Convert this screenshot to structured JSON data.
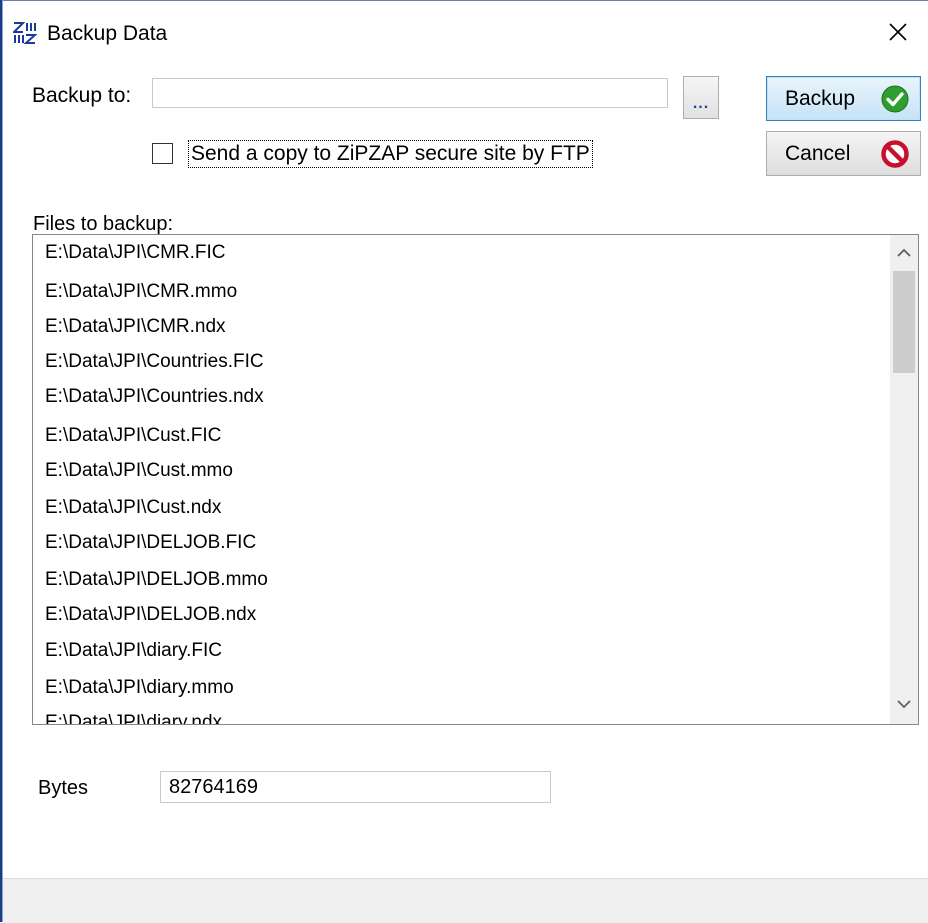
{
  "window": {
    "title": "Backup Data",
    "app_icon": "zipzap-logo-icon",
    "close_icon": "close-icon"
  },
  "backup_to": {
    "label": "Backup to:",
    "value": "",
    "browse_label": "..."
  },
  "ftp": {
    "checked": false,
    "label": "Send a copy to ZiPZAP secure site by FTP"
  },
  "buttons": {
    "backup_label": "Backup",
    "backup_icon": "check-circle-icon",
    "cancel_label": "Cancel",
    "cancel_icon": "no-entry-icon"
  },
  "files": {
    "label": "Files to backup:",
    "items": [
      "E:\\Data\\JPI\\CMR.FIC",
      "E:\\Data\\JPI\\CMR.mmo",
      "E:\\Data\\JPI\\CMR.ndx",
      "E:\\Data\\JPI\\Countries.FIC",
      "E:\\Data\\JPI\\Countries.ndx",
      "E:\\Data\\JPI\\Cust.FIC",
      "E:\\Data\\JPI\\Cust.mmo",
      "E:\\Data\\JPI\\Cust.ndx",
      "E:\\Data\\JPI\\DELJOB.FIC",
      "E:\\Data\\JPI\\DELJOB.mmo",
      "E:\\Data\\JPI\\DELJOB.ndx",
      "E:\\Data\\JPI\\diary.FIC",
      "E:\\Data\\JPI\\diary.mmo",
      "E:\\Data\\JPI\\diary.ndx"
    ]
  },
  "bytes": {
    "label": "Bytes",
    "value": "82764169"
  },
  "colors": {
    "backup_button_border": "#3c7fb1",
    "check_green": "#2e9e2e",
    "cancel_red": "#c8102e"
  }
}
